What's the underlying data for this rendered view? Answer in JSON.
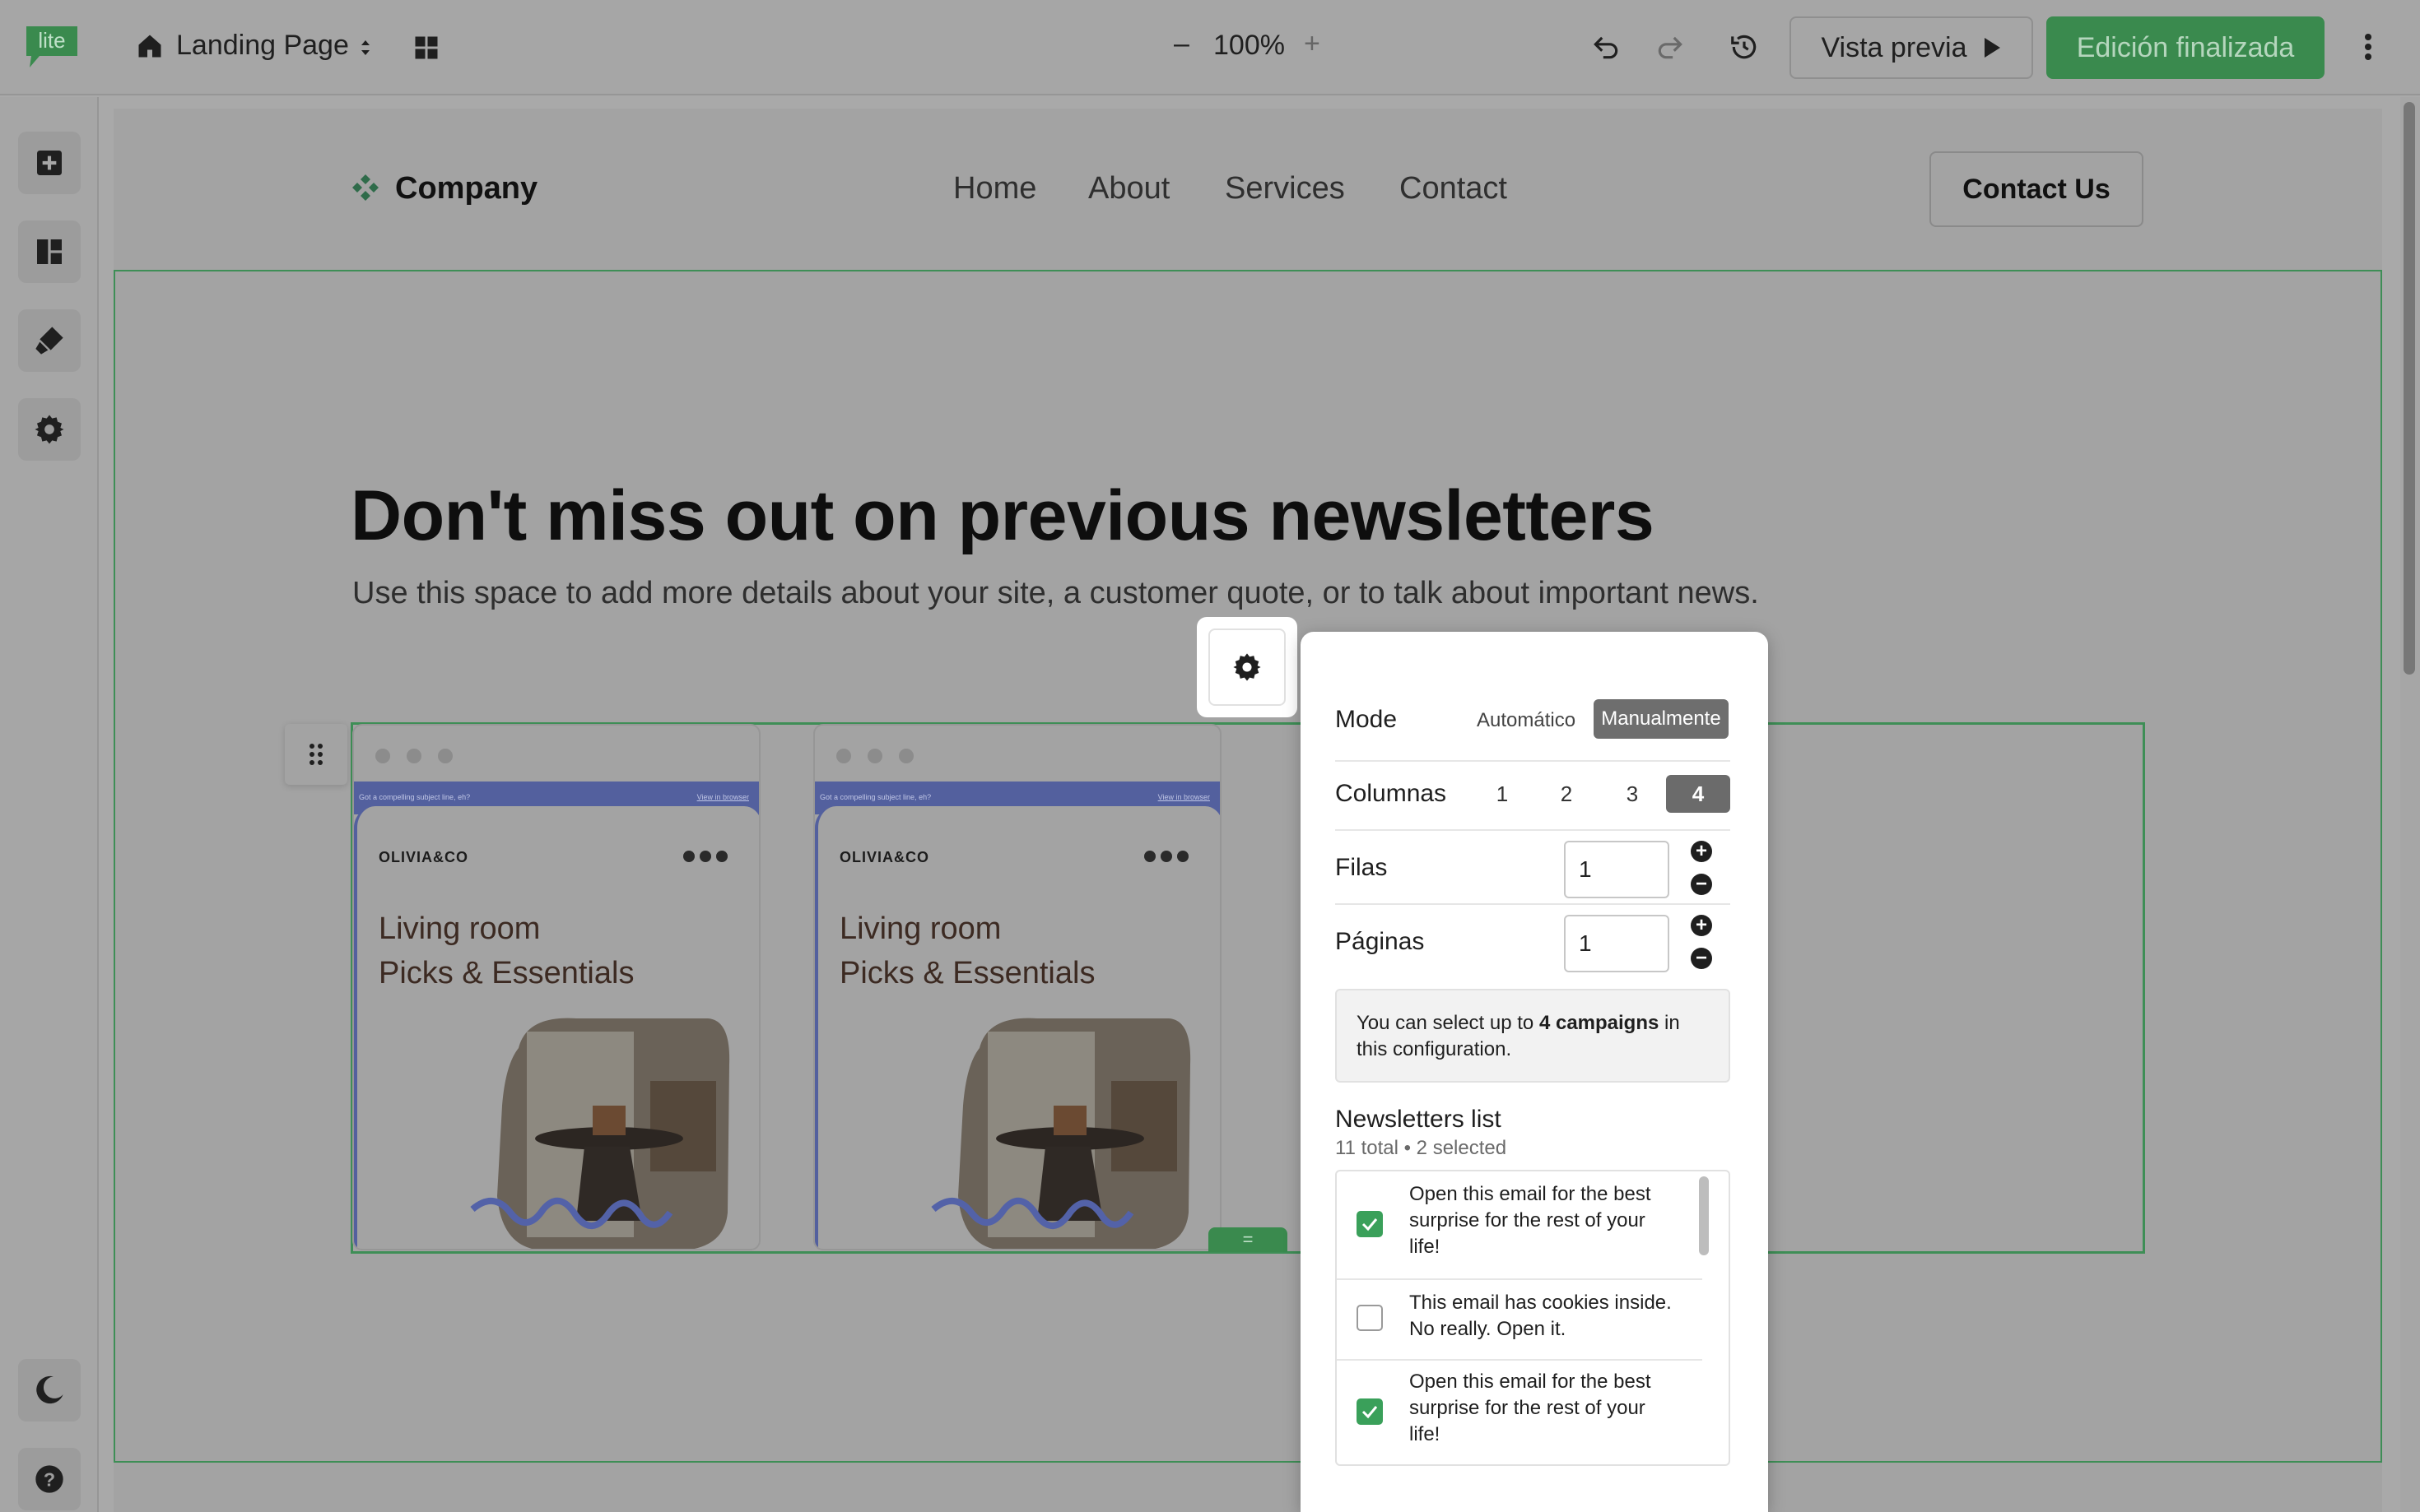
{
  "app": {
    "logo_text": "lite",
    "page_name": "Landing Page",
    "zoom": "100%",
    "zoom_minus": "–",
    "zoom_plus": "+",
    "preview_label": "Vista previa",
    "finish_label": "Edición finalizada"
  },
  "site": {
    "company": "Company",
    "nav": [
      "Home",
      "About",
      "Services",
      "Contact"
    ],
    "contact_button": "Contact Us",
    "headline": "Don't miss out on previous newsletters",
    "subtitle": "Use this space to add more details about your site, a customer quote, or to talk about important news.",
    "cards": [
      {
        "preheader": "Got a compelling subject line, eh?",
        "view_link": "View in browser",
        "brand": "OLIVIA&CO",
        "title_line1": "Living room",
        "title_line2": "Picks & Essentials"
      },
      {
        "preheader": "Got a compelling subject line, eh?",
        "view_link": "View in browser",
        "brand": "OLIVIA&CO",
        "title_line1": "Living room",
        "title_line2": "Picks & Essentials"
      }
    ],
    "drag_tab": "="
  },
  "panel": {
    "mode_label": "Mode",
    "mode_auto": "Automático",
    "mode_manual": "Manualmente",
    "mode_selected": "Manualmente",
    "columns_label": "Columnas",
    "columns_options": [
      "1",
      "2",
      "3",
      "4"
    ],
    "columns_selected": "4",
    "rows_label": "Filas",
    "rows_value": "1",
    "pages_label": "Páginas",
    "pages_value": "1",
    "info_prefix": "You can select up to ",
    "info_bold": "4 campaigns",
    "info_suffix": " in this configuration.",
    "list_title": "Newsletters list",
    "list_count": "11 total • 2 selected",
    "newsletters": [
      {
        "label": "Open this email for the best surprise for the rest of your life!",
        "checked": true
      },
      {
        "label": "This email has cookies inside. No really. Open it.",
        "checked": false
      },
      {
        "label": "Open this email for the best surprise for the rest of your life!",
        "checked": true
      }
    ]
  },
  "colors": {
    "accent_green": "#3a8a4e",
    "brand_blue": "#53609e",
    "selected_gray": "#6b6b6b"
  }
}
